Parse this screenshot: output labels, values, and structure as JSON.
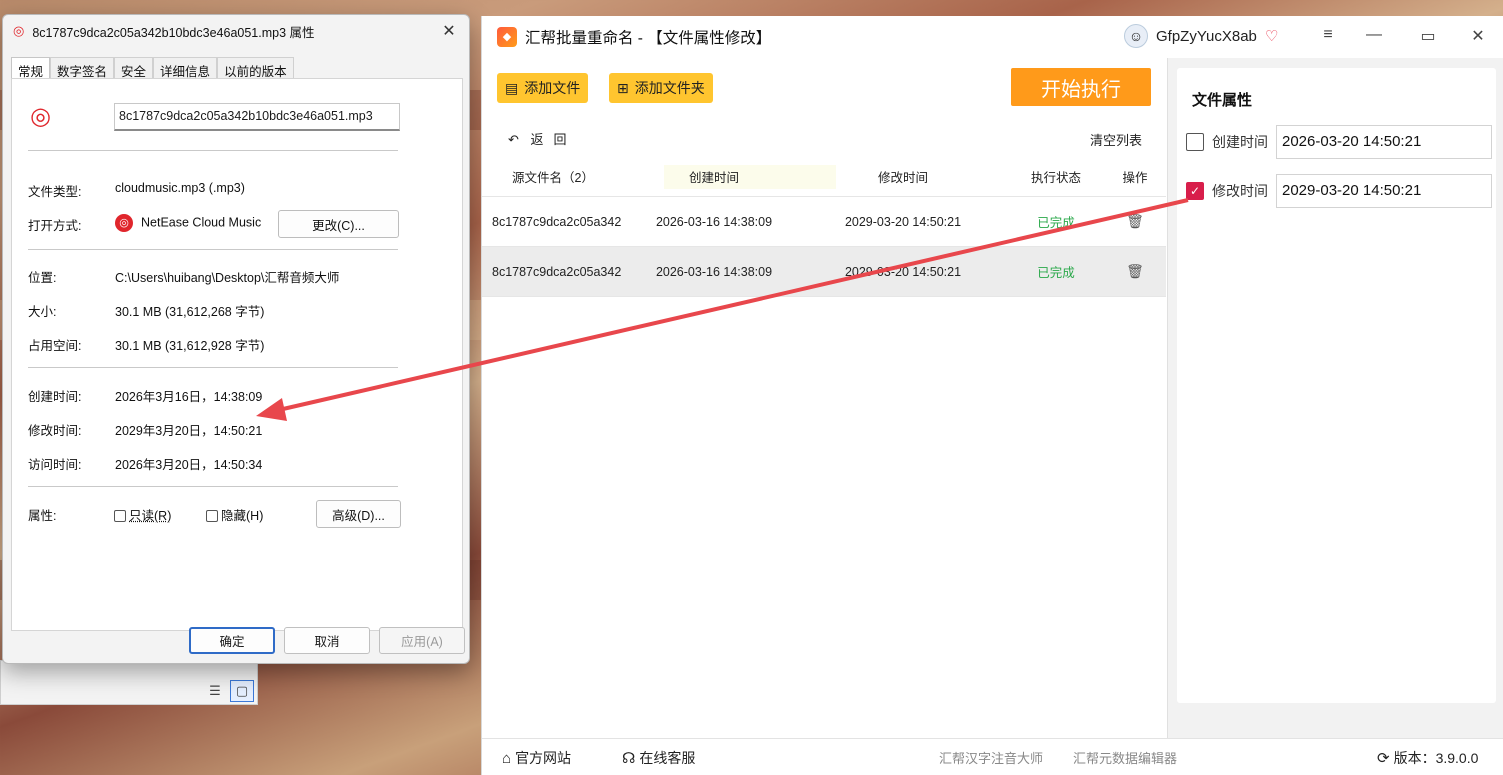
{
  "properties_dialog": {
    "title": "8c1787c9dca2c05a342b10bdc3e46a051.mp3 属性",
    "tabs": [
      "常规",
      "数字签名",
      "安全",
      "详细信息",
      "以前的版本"
    ],
    "file_name": "8c1787c9dca2c05a342b10bdc3e46a051.mp3",
    "file_type_label": "文件类型:",
    "file_type_value": "cloudmusic.mp3 (.mp3)",
    "open_with_label": "打开方式:",
    "open_with_value": "NetEase Cloud Music",
    "change_button": "更改(C)...",
    "location_label": "位置:",
    "location_value": "C:\\Users\\huibang\\Desktop\\汇帮音频大师",
    "size_label": "大小:",
    "size_value": "30.1 MB (31,612,268 字节)",
    "disk_size_label": "占用空间:",
    "disk_size_value": "30.1 MB (31,612,928 字节)",
    "created_label": "创建时间:",
    "created_value": "2026年3月16日，14:38:09",
    "modified_label": "修改时间:",
    "modified_value": "2029年3月20日，14:50:21",
    "accessed_label": "访问时间:",
    "accessed_value": "2026年3月20日，14:50:34",
    "attributes_label": "属性:",
    "readonly_label": "只读(R)",
    "hidden_label": "隐藏(H)",
    "advanced_button": "高级(D)...",
    "ok_button": "确定",
    "cancel_button": "取消",
    "apply_button": "应用(A)"
  },
  "app": {
    "title": "汇帮批量重命名 - 【文件属性修改】",
    "username": "GfpZyYucX8ab",
    "add_file": "添加文件",
    "add_folder": "添加文件夹",
    "start": "开始执行",
    "back": "返回",
    "clear_list": "清空列表",
    "columns": [
      "源文件名（2）",
      "创建时间",
      "修改时间",
      "执行状态",
      "操作"
    ],
    "rows": [
      {
        "name": "8c1787c9dca2c05a342",
        "created": "2026-03-16 14:38:09",
        "modified": "2029-03-20 14:50:21",
        "status": "已完成"
      },
      {
        "name": "8c1787c9dca2c05a342",
        "created": "2026-03-16 14:38:09",
        "modified": "2029-03-20 14:50:21",
        "status": "已完成"
      }
    ],
    "attr_panel_title": "文件属性",
    "attr_created_label": "创建时间",
    "attr_created_value": "2026-03-20 14:50:21",
    "attr_created_checked": false,
    "attr_modified_label": "修改时间",
    "attr_modified_value": "2029-03-20 14:50:21",
    "attr_modified_checked": true,
    "status_official_site": "官方网站",
    "status_online_service": "在线客服",
    "status_link1": "汇帮汉字注音大师",
    "status_link2": "汇帮元数据编辑器",
    "version": "版本：3.9.0.0"
  },
  "colors": {
    "accent_yellow": "#ffc52f",
    "start_orange": "#ff9a1a",
    "done_green": "#2aa84a",
    "checkbox_red": "#d81e4b",
    "arrow_red": "#e8474c"
  }
}
